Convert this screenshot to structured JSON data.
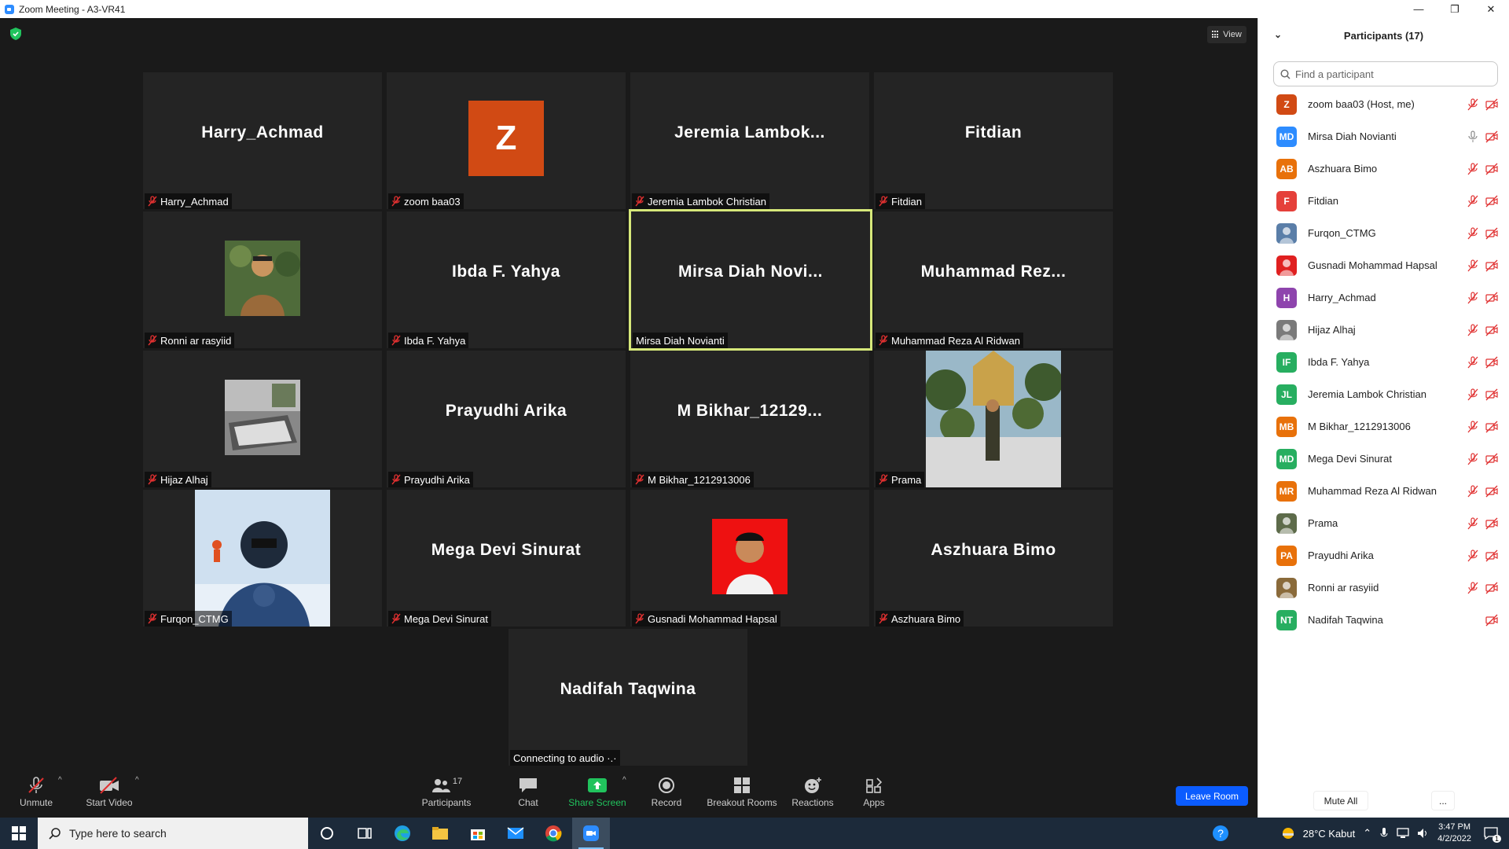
{
  "window": {
    "title": "Zoom Meeting - A3-VR41",
    "minimize": "—",
    "restore": "❐",
    "close": "✕"
  },
  "view_button": {
    "label": "View"
  },
  "tiles": [
    {
      "name": "Harry_Achmad",
      "center": "Harry_Achmad",
      "type": "text"
    },
    {
      "name": "zoom baa03",
      "center": "Z",
      "type": "avatar",
      "color": "#d14a14"
    },
    {
      "name": "Jeremia Lambok Christian",
      "center": "Jeremia  Lambok...",
      "type": "text"
    },
    {
      "name": "Fitdian",
      "center": "Fitdian",
      "type": "text"
    },
    {
      "name": "Ronni ar rasyiid",
      "center": "",
      "type": "photo"
    },
    {
      "name": "Ibda F. Yahya",
      "center": "Ibda F. Yahya",
      "type": "text"
    },
    {
      "name": "Mirsa Diah Novianti",
      "center": "Mirsa  Diah  Novi...",
      "type": "text",
      "active": true
    },
    {
      "name": "Muhammad Reza Al Ridwan",
      "center": "Muhammad  Rez...",
      "type": "text"
    },
    {
      "name": "Hijaz Alhaj",
      "center": "",
      "type": "photo"
    },
    {
      "name": "Prayudhi Arika",
      "center": "Prayudhi Arika",
      "type": "text"
    },
    {
      "name": "M Bikhar_1212913006",
      "center": "M  Bikhar_12129...",
      "type": "text"
    },
    {
      "name": "Prama",
      "center": "",
      "type": "photo-tall"
    },
    {
      "name": "Furqon_CTMG",
      "center": "",
      "type": "photo-tall"
    },
    {
      "name": "Mega Devi Sinurat",
      "center": "Mega Devi Sinurat",
      "type": "text"
    },
    {
      "name": "Gusnadi Mohammad Hapsal",
      "center": "",
      "type": "photo"
    },
    {
      "name": "Aszhuara Bimo",
      "center": "Aszhuara Bimo",
      "type": "text"
    }
  ],
  "last_tile": {
    "center": "Nadifah Taqwina",
    "label": "Connecting to audio ·.·"
  },
  "toolbar": {
    "unmute": "Unmute",
    "start_video": "Start Video",
    "participants": "Participants",
    "participants_count": "17",
    "chat": "Chat",
    "share_screen": "Share Screen",
    "record": "Record",
    "breakout": "Breakout Rooms",
    "reactions": "Reactions",
    "apps": "Apps",
    "leave": "Leave Room"
  },
  "panel": {
    "title": "Participants (17)",
    "search_placeholder": "Find a participant",
    "mute_all": "Mute All",
    "more": "...",
    "participants": [
      {
        "initials": "Z",
        "name": "zoom baa03 (Host, me)",
        "color": "#d14a14",
        "mic": "muted"
      },
      {
        "initials": "MD",
        "name": "Mirsa Diah Novianti",
        "color": "#2d8cff",
        "mic": "on"
      },
      {
        "initials": "AB",
        "name": "Aszhuara Bimo",
        "color": "#e8710a",
        "mic": "muted"
      },
      {
        "initials": "F",
        "name": "Fitdian",
        "color": "#e5403a",
        "mic": "muted"
      },
      {
        "initials": "",
        "name": "Furqon_CTMG",
        "color": "#5a7ea8",
        "mic": "muted"
      },
      {
        "initials": "",
        "name": "Gusnadi Mohammad Hapsal",
        "color": "#e02020",
        "mic": "muted"
      },
      {
        "initials": "H",
        "name": "Harry_Achmad",
        "color": "#8e44ad",
        "mic": "muted"
      },
      {
        "initials": "",
        "name": "Hijaz Alhaj",
        "color": "#7a7a7a",
        "mic": "muted"
      },
      {
        "initials": "IF",
        "name": "Ibda F. Yahya",
        "color": "#27ae60",
        "mic": "muted"
      },
      {
        "initials": "JL",
        "name": "Jeremia Lambok Christian",
        "color": "#27ae60",
        "mic": "muted"
      },
      {
        "initials": "MB",
        "name": "M Bikhar_1212913006",
        "color": "#e8710a",
        "mic": "muted"
      },
      {
        "initials": "MD",
        "name": "Mega Devi Sinurat",
        "color": "#27ae60",
        "mic": "muted"
      },
      {
        "initials": "MR",
        "name": "Muhammad Reza Al Ridwan",
        "color": "#e8710a",
        "mic": "muted"
      },
      {
        "initials": "",
        "name": "Prama",
        "color": "#5d6b4a",
        "mic": "muted"
      },
      {
        "initials": "PA",
        "name": "Prayudhi Arika",
        "color": "#e8710a",
        "mic": "muted"
      },
      {
        "initials": "",
        "name": "Ronni ar rasyiid",
        "color": "#8a6a3a",
        "mic": "muted"
      },
      {
        "initials": "NT",
        "name": "Nadifah Taqwina",
        "color": "#27ae60",
        "mic": "none"
      }
    ]
  },
  "taskbar": {
    "search_placeholder": "Type here to search",
    "weather": "28°C  Kabut",
    "time": "3:47 PM",
    "date": "4/2/2022",
    "notifications": "1"
  }
}
